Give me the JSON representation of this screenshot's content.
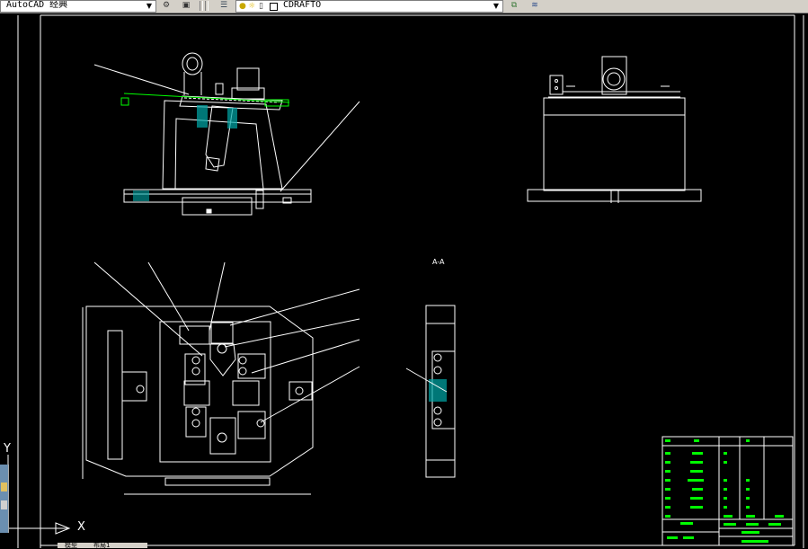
{
  "toolbar": {
    "workspace_value": "AutoCAD 经典",
    "layer_value": "CDRAFTO",
    "icons": [
      "workspace-settings-icon",
      "toolbar-lock-icon",
      "layer-manager-icon",
      "lightbulb-icon",
      "sun-icon",
      "lock-icon",
      "color-square-icon",
      "make-current-layer-icon",
      "layer-previous-icon"
    ]
  },
  "drawing": {
    "ucs_y_label": "Y",
    "ucs_x_label": "X",
    "section_label": "A-A",
    "colors": {
      "background": "#000000",
      "lines": "#ffffff",
      "highlight": "#00ff00",
      "hatch": "#00aaaa"
    }
  },
  "layout_tabs": [
    "模型",
    "布局1"
  ]
}
